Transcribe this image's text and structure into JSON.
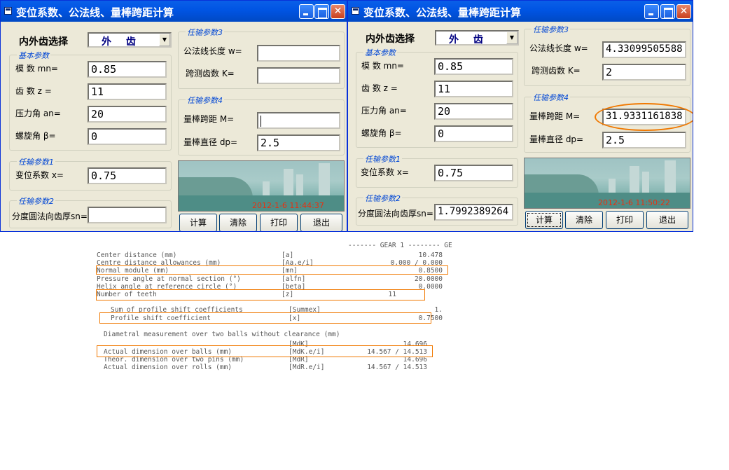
{
  "window1": {
    "title": "变位系数、公法线、量棒跨距计算",
    "gear_type_label": "内外齿选择",
    "gear_type_value": "外 齿",
    "basic_group": "基本参数",
    "module_label": "模  数 mn=",
    "module_value": "0.85",
    "teeth_label": "齿  数 z =",
    "teeth_value": "11",
    "pressure_label": "压力角 an=",
    "pressure_value": "20",
    "helix_label": "螺旋角 β=",
    "helix_value": "0",
    "g1_group": "任输参数1",
    "shift_label": "变位系数 x=",
    "shift_value": "0.75",
    "g2_group": "任输参数2",
    "thick_label": "分度圆法向齿厚sn=",
    "thick_value": "",
    "g3_group": "任输参数3",
    "wlen_label": "公法线长度 w=",
    "wlen_value": "",
    "kspan_label": "跨测齿数 K=",
    "kspan_value": "",
    "g4_group": "任输参数4",
    "m_label": "量棒跨距  M=",
    "m_value": "",
    "dp_label": "量棒直径 dp=",
    "dp_value": "2.5",
    "timestamp": "2012-1-6 11:44:37",
    "btn_calc": "计算",
    "btn_clear": "清除",
    "btn_print": "打印",
    "btn_exit": "退出"
  },
  "window2": {
    "title": "变位系数、公法线、量棒跨距计算",
    "gear_type_label": "内外齿选择",
    "gear_type_value": "外 齿",
    "basic_group": "基本参数",
    "module_label": "模  数 mn=",
    "module_value": "0.85",
    "teeth_label": "齿  数 z =",
    "teeth_value": "11",
    "pressure_label": "压力角 an=",
    "pressure_value": "20",
    "helix_label": "螺旋角 β=",
    "helix_value": "0",
    "g1_group": "任输参数1",
    "shift_label": "变位系数 x=",
    "shift_value": "0.75",
    "g2_group": "任输参数2",
    "thick_label": "分度圆法向齿厚sn=",
    "thick_value": "1.7992389264",
    "g3_group": "任输参数3",
    "wlen_label": "公法线长度 w=",
    "wlen_value": "4.33099505588",
    "kspan_label": "跨测齿数 K=",
    "kspan_value": "2",
    "g4_group": "任输参数4",
    "m_label": "量棒跨距  M=",
    "m_value": "31.9331161838",
    "dp_label": "量棒直径 dp=",
    "dp_value": "2.5",
    "timestamp": "2012-1-6 11:50:22",
    "btn_calc": "计算",
    "btn_clear": "清除",
    "btn_print": "打印",
    "btn_exit": "退出"
  },
  "report": {
    "header": "------- GEAR 1 -------- GE",
    "lines": [
      {
        "label": "Center distance (mm)",
        "sym": "[a]",
        "val": "10.478"
      },
      {
        "label": "Centre distance allowances (mm)",
        "sym": "[Aa.e/i]",
        "val": "0.000 / 0.000"
      },
      {
        "label": "Normal module (mm)",
        "sym": "[mn]",
        "val": "0.8500"
      },
      {
        "label": "Pressure angle at normal section (°)",
        "sym": "[alfn]",
        "val": "20.0000"
      },
      {
        "label": "Helix angle at reference circle (°)",
        "sym": "[beta]",
        "val": "0.0000"
      },
      {
        "label": "Number of teeth",
        "sym": "[z]",
        "val": "11"
      },
      {
        "label": "Sum of profile shift coefficients",
        "sym": "[Summex]",
        "val": "1."
      },
      {
        "label": "Profile shift coefficient",
        "sym": "[x]",
        "val": "0.7500"
      },
      {
        "label": "Diametral measurement over two balls without clearance (mm)",
        "sym": "",
        "val": ""
      },
      {
        "label": "",
        "sym": "[MdK]",
        "val": "14.696"
      },
      {
        "label": "Actual dimension over balls (mm)",
        "sym": "[MdK.e/i]",
        "val": "14.567 / 14.513"
      },
      {
        "label": "Theor. dimension over two pins (mm)",
        "sym": "[MdR]",
        "val": "14.696"
      },
      {
        "label": "Actual dimension over rolls (mm)",
        "sym": "[MdR.e/i]",
        "val": "14.567 / 14.513"
      }
    ]
  }
}
